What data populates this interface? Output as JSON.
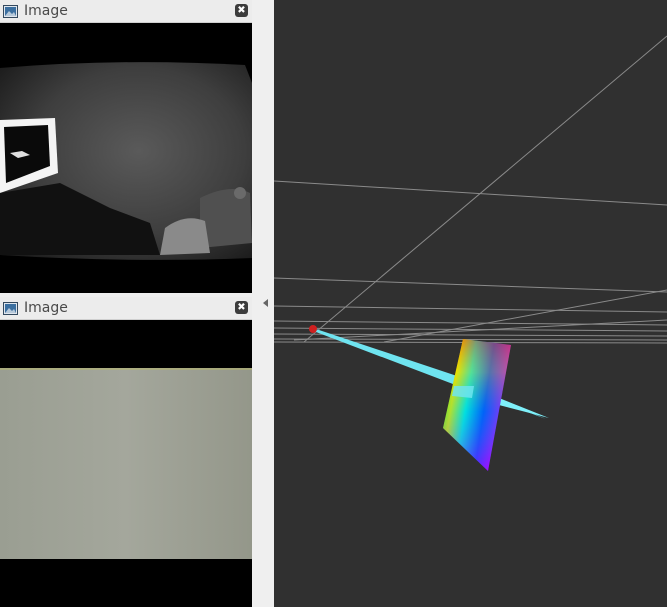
{
  "window_top": {
    "title": "Image",
    "close_icon": "close-icon"
  },
  "window_bottom": {
    "title": "Image",
    "close_icon": "close-icon"
  },
  "splitter": {
    "icon": "collapse-left-arrow-icon"
  },
  "viewport": {
    "background": "#303030",
    "grid_color": "#a0a0a0",
    "arrow_color": "#6fe4f0",
    "origin_color": "#d02020"
  }
}
